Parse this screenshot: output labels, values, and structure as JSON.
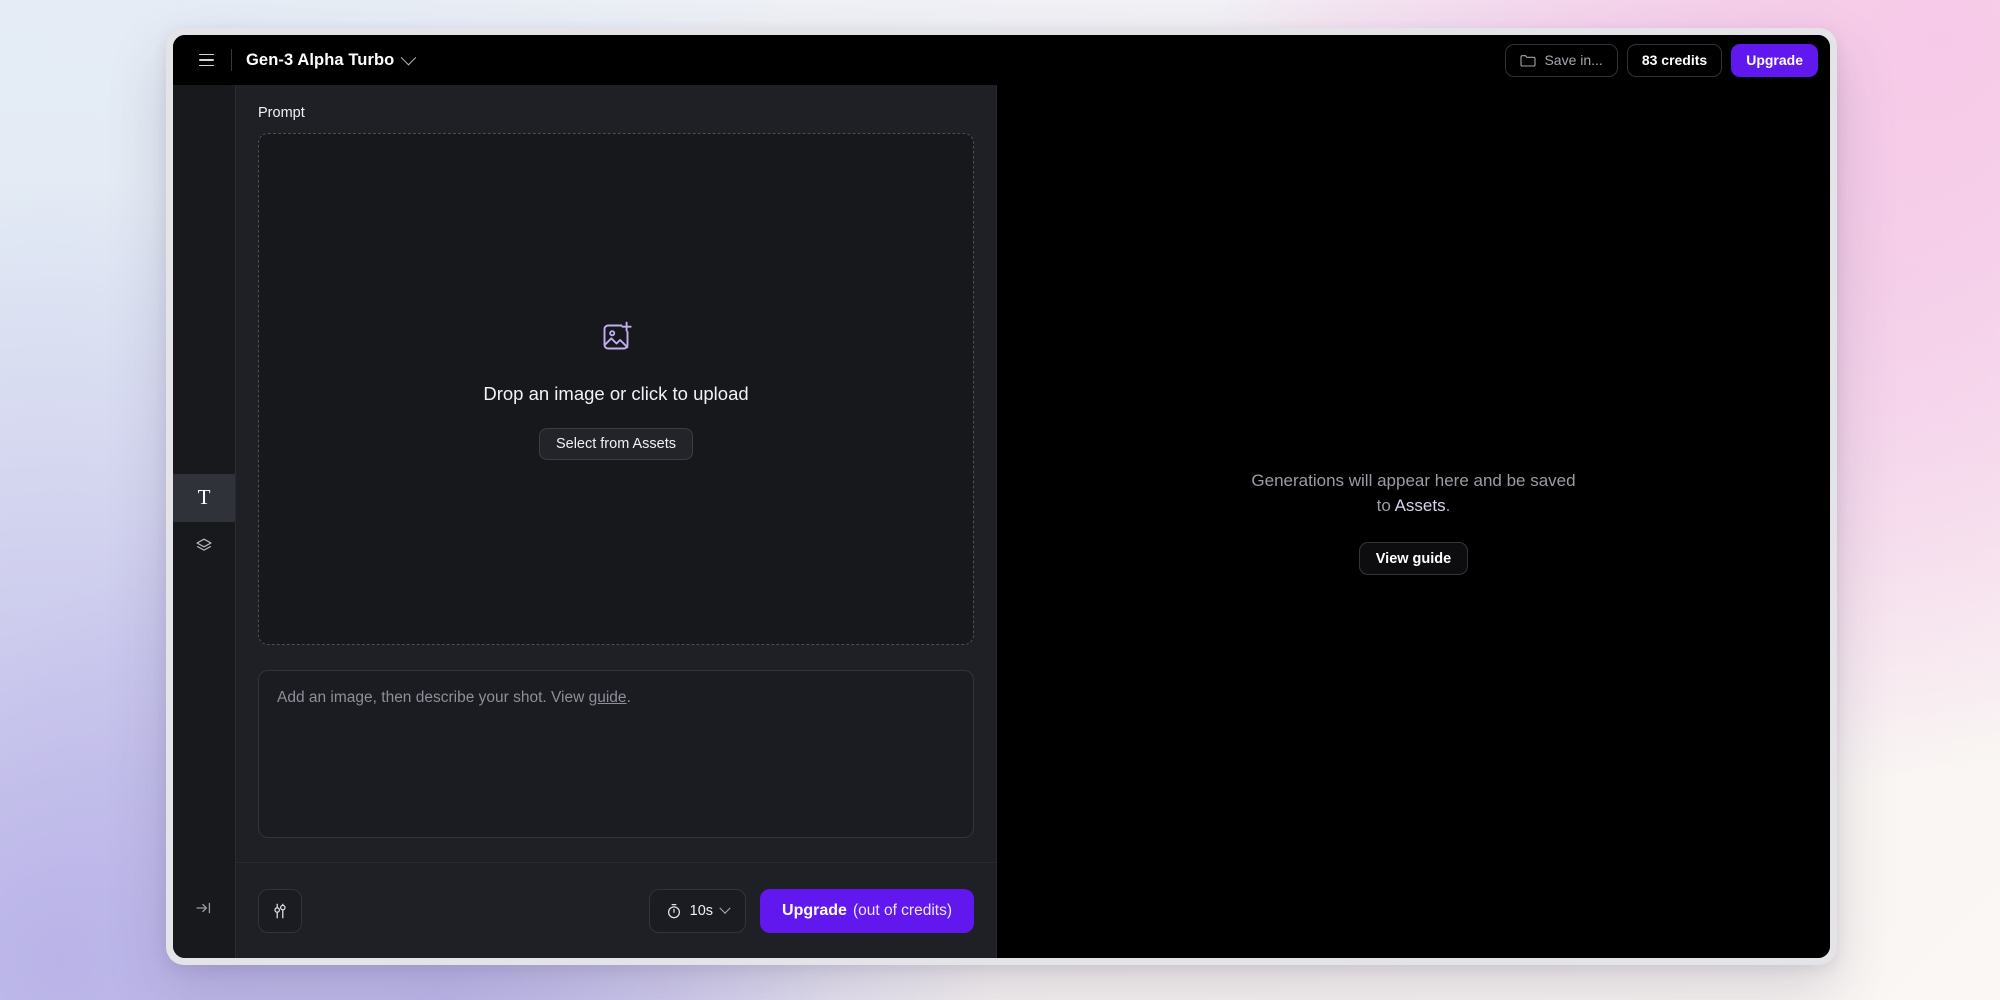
{
  "titlebar": {
    "menu_icon": "hamburger-icon",
    "model_name": "Gen-3 Alpha Turbo",
    "model_chevron": "chevron-down-icon",
    "save_in_label": "Save in...",
    "save_in_icon": "folder-icon",
    "credits_label": "83 credits",
    "upgrade_label": "Upgrade"
  },
  "rail": {
    "tools": [
      {
        "name": "text-tool",
        "icon": "text-icon",
        "glyph": "T",
        "active": true
      },
      {
        "name": "layers-tool",
        "icon": "layers-icon",
        "active": false
      }
    ],
    "collapse_icon": "arrow-to-line-icon"
  },
  "prompt_panel": {
    "label": "Prompt",
    "dropzone": {
      "icon": "image-plus-icon",
      "title": "Drop an image or click to upload",
      "button_label": "Select from Assets"
    },
    "textarea": {
      "placeholder_before": "Add an image, then describe your shot. View ",
      "placeholder_link": "guide",
      "placeholder_after": ".",
      "value": ""
    },
    "toolbar": {
      "settings_icon": "sliders-icon",
      "duration_icon": "stopwatch-icon",
      "duration_value": "10s",
      "duration_chevron": "chevron-down-icon",
      "generate_bold": "Upgrade",
      "generate_light": "(out of credits)"
    }
  },
  "canvas": {
    "empty_text_before": "Generations will appear here and be saved to ",
    "empty_text_accent": "Assets",
    "empty_text_after": ".",
    "view_guide_label": "View guide"
  },
  "colors": {
    "accent_purple": "#6018ee",
    "panel_bg": "#1e2025",
    "canvas_bg": "#000000",
    "rail_bg": "#18191d",
    "icon_lavender": "#c3aef0"
  }
}
